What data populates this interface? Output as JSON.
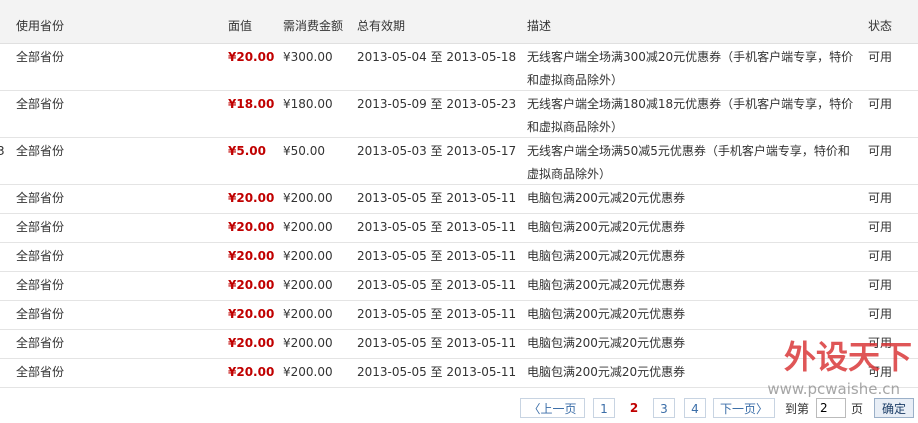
{
  "header": {
    "province": "使用省份",
    "face_value": "面值",
    "min_amount": "需消费金额",
    "validity": "总有效期",
    "description": "描述",
    "status": "状态"
  },
  "rows": [
    {
      "edge": "",
      "province": "全部省份",
      "face_value": "¥20.00",
      "min_amount": "¥300.00",
      "validity": "2013-05-04 至 2013-05-18",
      "desc1": "无线客户端全场满300减20元优惠券（手机客户端专享，特价",
      "desc2": "和虚拟商品除外）",
      "status": "可用"
    },
    {
      "edge": "",
      "province": "全部省份",
      "face_value": "¥18.00",
      "min_amount": "¥180.00",
      "validity": "2013-05-09 至 2013-05-23",
      "desc1": "无线客户端全场满180减18元优惠券（手机客户端专享，特价",
      "desc2": "和虚拟商品除外）",
      "status": "可用"
    },
    {
      "edge": "3",
      "province": "全部省份",
      "face_value": "¥5.00",
      "min_amount": "¥50.00",
      "validity": "2013-05-03 至 2013-05-17",
      "desc1": "无线客户端全场满50减5元优惠券（手机客户端专享，特价和",
      "desc2": "虚拟商品除外）",
      "status": "可用"
    },
    {
      "edge": "",
      "province": "全部省份",
      "face_value": "¥20.00",
      "min_amount": "¥200.00",
      "validity": "2013-05-05 至 2013-05-11",
      "desc1": "电脑包满200元减20元优惠券",
      "desc2": "",
      "status": "可用"
    },
    {
      "edge": "",
      "province": "全部省份",
      "face_value": "¥20.00",
      "min_amount": "¥200.00",
      "validity": "2013-05-05 至 2013-05-11",
      "desc1": "电脑包满200元减20元优惠券",
      "desc2": "",
      "status": "可用"
    },
    {
      "edge": "",
      "province": "全部省份",
      "face_value": "¥20.00",
      "min_amount": "¥200.00",
      "validity": "2013-05-05 至 2013-05-11",
      "desc1": "电脑包满200元减20元优惠券",
      "desc2": "",
      "status": "可用"
    },
    {
      "edge": "",
      "province": "全部省份",
      "face_value": "¥20.00",
      "min_amount": "¥200.00",
      "validity": "2013-05-05 至 2013-05-11",
      "desc1": "电脑包满200元减20元优惠券",
      "desc2": "",
      "status": "可用"
    },
    {
      "edge": "",
      "province": "全部省份",
      "face_value": "¥20.00",
      "min_amount": "¥200.00",
      "validity": "2013-05-05 至 2013-05-11",
      "desc1": "电脑包满200元减20元优惠券",
      "desc2": "",
      "status": "可用"
    },
    {
      "edge": "",
      "province": "全部省份",
      "face_value": "¥20.00",
      "min_amount": "¥200.00",
      "validity": "2013-05-05 至 2013-05-11",
      "desc1": "电脑包满200元减20元优惠券",
      "desc2": "",
      "status": "可用"
    },
    {
      "edge": "",
      "province": "全部省份",
      "face_value": "¥20.00",
      "min_amount": "¥200.00",
      "validity": "2013-05-05 至 2013-05-11",
      "desc1": "电脑包满200元减20元优惠券",
      "desc2": "",
      "status": "可用"
    }
  ],
  "pagination": {
    "prev": "〈上一页",
    "pages": [
      "1",
      "2",
      "3",
      "4"
    ],
    "current": "2",
    "next": "下一页〉",
    "goto_prefix": "到第",
    "goto_value": "2",
    "goto_suffix": "页",
    "confirm": "确定"
  },
  "watermark": {
    "brand": "外设天下",
    "url": "www.pcwaishe.cn"
  },
  "colors": {
    "price_red": "#c00000",
    "link_blue": "#3b6ea8",
    "header_bg": "#f3f3f3",
    "watermark_red": "#d9383a"
  }
}
